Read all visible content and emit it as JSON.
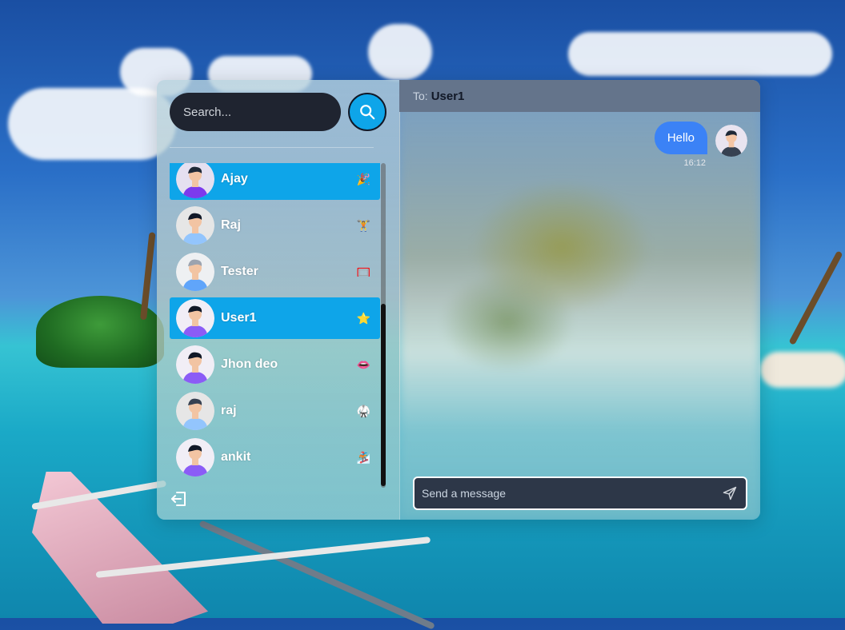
{
  "search": {
    "placeholder": "Search..."
  },
  "contacts": [
    {
      "name": "Ajay",
      "emoji": "🎉",
      "active": true
    },
    {
      "name": "Raj",
      "emoji": "🏋",
      "active": false
    },
    {
      "name": "Tester",
      "emoji": "🥅",
      "active": false
    },
    {
      "name": "User1",
      "emoji": "⭐",
      "active": true
    },
    {
      "name": "Jhon deo",
      "emoji": "👄",
      "active": false
    },
    {
      "name": "raj",
      "emoji": "🥋",
      "active": false
    },
    {
      "name": "ankit",
      "emoji": "🏂",
      "active": false
    }
  ],
  "chat": {
    "to_label": "To:",
    "to_name": "User1",
    "messages": [
      {
        "text": "Hello",
        "time": "16:12",
        "from_me": true
      }
    ],
    "composer_placeholder": "Send a message"
  },
  "colors": {
    "accent": "#0ea5e9",
    "bubble": "#3b82f6",
    "header": "#64748b",
    "search_bg": "#1f2430"
  },
  "icons": {
    "search": "search-icon",
    "logout": "logout-icon",
    "send": "send-icon"
  }
}
